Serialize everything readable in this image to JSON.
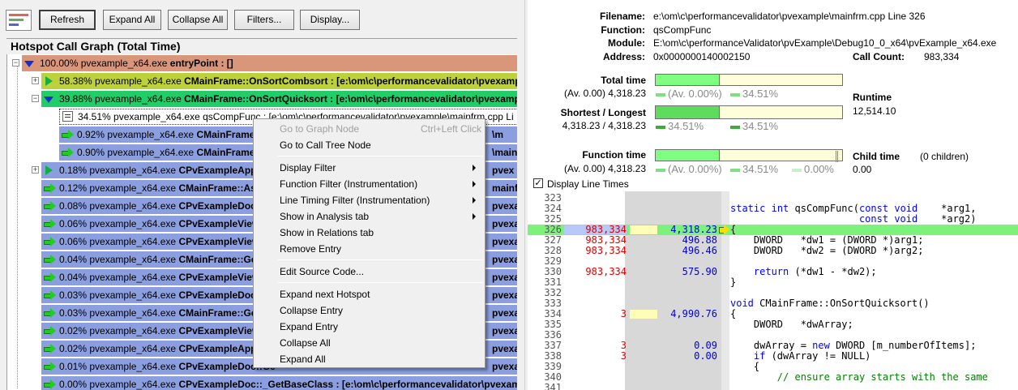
{
  "toolbar": {
    "refresh": "Refresh",
    "expand_all": "Expand All",
    "collapse_all": "Collapse All",
    "filters": "Filters...",
    "display": "Display..."
  },
  "graph": {
    "title": "Hotspot Call Graph (Total Time)",
    "rows": [
      {
        "pct": "100.00%",
        "module": "pvexample_x64.exe",
        "func": "entryPoint : []",
        "color": "#d9967b"
      },
      {
        "pct": "58.38%",
        "module": "pvexample_x64.exe",
        "func": "CMainFrame::OnSortCombsort : [e:\\om\\c\\performancevalidator\\pvexample\\",
        "color": "#bcd13a"
      },
      {
        "pct": "39.88%",
        "module": "pvexample_x64.exe",
        "func": "CMainFrame::OnSortQuicksort : [e:\\om\\c\\performancevalidator\\pvexample\\",
        "color": "#22cc66"
      },
      {
        "pct": "34.51%",
        "module": "pvexample_x64.exe",
        "func": "qsCompFunc : [e:\\om\\c\\performancevalidator\\pvexample\\mainfrm.cpp Li",
        "color": "#ffffff"
      },
      {
        "pct": "0.92%",
        "module": "pvexample_x64.exe",
        "func": "CMainFrame::pop",
        "tail": "\\m",
        "color": "#8b9fe0"
      },
      {
        "pct": "0.90%",
        "module": "pvexample_x64.exe",
        "func": "CMainFrame::che",
        "tail": "\\main",
        "color": "#8b9fe0"
      },
      {
        "pct": "0.18%",
        "module": "pvexample_x64.exe",
        "func": "CPvExampleApp::In",
        "tail": "pvex",
        "color": "#8b9fe0"
      },
      {
        "pct": "0.12%",
        "module": "pvexample_x64.exe",
        "func": "CMainFrame::Assert",
        "tail": "mainfr",
        "color": "#8b9fe0"
      },
      {
        "pct": "0.08%",
        "module": "pvexample_x64.exe",
        "func": "CPvExampleDoc::As",
        "tail": "pvexam",
        "color": "#8b9fe0"
      },
      {
        "pct": "0.06%",
        "module": "pvexample_x64.exe",
        "func": "CPvExampleView::C",
        "tail": "pvexam",
        "color": "#8b9fe0"
      },
      {
        "pct": "0.06%",
        "module": "pvexample_x64.exe",
        "func": "CPvExampleView::A",
        "tail": "pvexam",
        "color": "#8b9fe0"
      },
      {
        "pct": "0.04%",
        "module": "pvexample_x64.exe",
        "func": "CMainFrame::GetM",
        "tail": "pvexamp",
        "color": "#8b9fe0"
      },
      {
        "pct": "0.04%",
        "module": "pvexample_x64.exe",
        "func": "CPvExampleView::O",
        "tail": "pvexamp",
        "color": "#8b9fe0"
      },
      {
        "pct": "0.03%",
        "module": "pvexample_x64.exe",
        "func": "CPvExampleDoc::Ge",
        "tail": "pvexamp",
        "color": "#8b9fe0"
      },
      {
        "pct": "0.03%",
        "module": "pvexample_x64.exe",
        "func": "CMainFrame::GetRu",
        "tail": "pvexamp",
        "color": "#8b9fe0"
      },
      {
        "pct": "0.02%",
        "module": "pvexample_x64.exe",
        "func": "CPvExampleView::_",
        "tail": "pvexamp",
        "color": "#8b9fe0"
      },
      {
        "pct": "0.02%",
        "module": "pvexample_x64.exe",
        "func": "CPvExampleApp::Ge",
        "tail": "pvexamp",
        "color": "#8b9fe0"
      },
      {
        "pct": "0.01%",
        "module": "pvexample_x64.exe",
        "func": "CPvExampleDoc::Ge",
        "tail": "pvexamp",
        "color": "#8b9fe0"
      },
      {
        "pct": "0.00%",
        "module": "pvexample_x64.exe",
        "func": "CPvExampleDoc::_GetBaseClass : [e:\\om\\c\\performancevalidator\\pvexample\\",
        "color": "#8b9fe0"
      }
    ]
  },
  "menu": {
    "items": [
      {
        "label": "Go to Graph Node",
        "shortcut": "Ctrl+Left Click",
        "disabled": true
      },
      {
        "label": "Go to Call Tree Node"
      },
      {
        "label": "Display Filter",
        "sub": true
      },
      {
        "label": "Function Filter (Instrumentation)",
        "sub": true
      },
      {
        "label": "Line Timing Filter (Instrumentation)",
        "sub": true
      },
      {
        "label": "Show in Analysis tab",
        "sub": true
      },
      {
        "label": "Show in Relations tab"
      },
      {
        "label": "Remove Entry"
      },
      {
        "label": "Edit Source Code..."
      },
      {
        "label": "Expand next Hotspot"
      },
      {
        "label": "Collapse Entry"
      },
      {
        "label": "Expand Entry"
      },
      {
        "label": "Collapse All"
      },
      {
        "label": "Expand All"
      }
    ]
  },
  "details": {
    "filename_label": "Filename:",
    "filename": "e:\\om\\c\\performancevalidator\\pvexample\\mainfrm.cpp Line 326",
    "function_label": "Function:",
    "function": "qsCompFunc",
    "module_label": "Module:",
    "module": "E:\\om\\c\\performanceValidator\\pvExample\\Debug10_0_x64\\pvExample_x64.exe",
    "address_label": "Address:",
    "address": "0x0000000140002150",
    "callcount_label": "Call Count:",
    "callcount": "983,334",
    "total_label": "Total time",
    "total_value": "(Av. 0.00) 4,318.23",
    "total_fill": 0.345,
    "total_leg1": "(Av. 0.00%)",
    "total_leg2": "34.51%",
    "runtime_label": "Runtime",
    "runtime": "12,514.10",
    "sl_label": "Shortest / Longest",
    "sl_value": "4,318.23 / 4,318.23",
    "sl_fill": 0.345,
    "sl_leg1": "34.51%",
    "sl_leg2": "34.51%",
    "func_label": "Function time",
    "func_value": "(Av. 0.00) 4,318.23",
    "func_fill": 0.345,
    "func_leg1": "(Av. 0.00%)",
    "func_leg2": "34.51%",
    "func_leg3": "0.00%",
    "child_label": "Child time",
    "child_count": "(0 children)",
    "child_value": "0.00",
    "display_line_times": "Display Line Times"
  },
  "code": {
    "lines": [
      {
        "n": "323",
        "count": "",
        "time": "",
        "src": ""
      },
      {
        "n": "324",
        "count": "",
        "time": "",
        "src": "static int qsCompFunc(const void    *arg1,"
      },
      {
        "n": "325",
        "count": "",
        "time": "",
        "src": "                      const void    *arg2)"
      },
      {
        "n": "326",
        "count": "983,334",
        "time": "4,318.23",
        "src": "{",
        "current": true
      },
      {
        "n": "327",
        "count": "983,334",
        "time": "496.88",
        "src": "    DWORD   *dw1 = (DWORD *)arg1;"
      },
      {
        "n": "328",
        "count": "983,334",
        "time": "496.46",
        "src": "    DWORD   *dw2 = (DWORD *)arg2;"
      },
      {
        "n": "329",
        "count": "",
        "time": "",
        "src": ""
      },
      {
        "n": "330",
        "count": "983,334",
        "time": "575.90",
        "src": "    return (*dw1 - *dw2);"
      },
      {
        "n": "331",
        "count": "",
        "time": "",
        "src": "}"
      },
      {
        "n": "332",
        "count": "",
        "time": "",
        "src": ""
      },
      {
        "n": "333",
        "count": "",
        "time": "",
        "src": "void CMainFrame::OnSortQuicksort()"
      },
      {
        "n": "334",
        "count": "3",
        "time": "4,990.76",
        "src": "{",
        "bar": true
      },
      {
        "n": "335",
        "count": "",
        "time": "",
        "src": "    DWORD   *dwArray;"
      },
      {
        "n": "336",
        "count": "",
        "time": "",
        "src": ""
      },
      {
        "n": "337",
        "count": "3",
        "time": "0.09",
        "src": "    dwArray = new DWORD [m_numberOfItems];"
      },
      {
        "n": "338",
        "count": "3",
        "time": "0.00",
        "src": "    if (dwArray != NULL)"
      },
      {
        "n": "339",
        "count": "",
        "time": "",
        "src": "    {"
      },
      {
        "n": "340",
        "count": "",
        "time": "",
        "src": "        // ensure array starts with the same"
      },
      {
        "n": "341",
        "count": "",
        "time": "",
        "src": ""
      }
    ]
  }
}
